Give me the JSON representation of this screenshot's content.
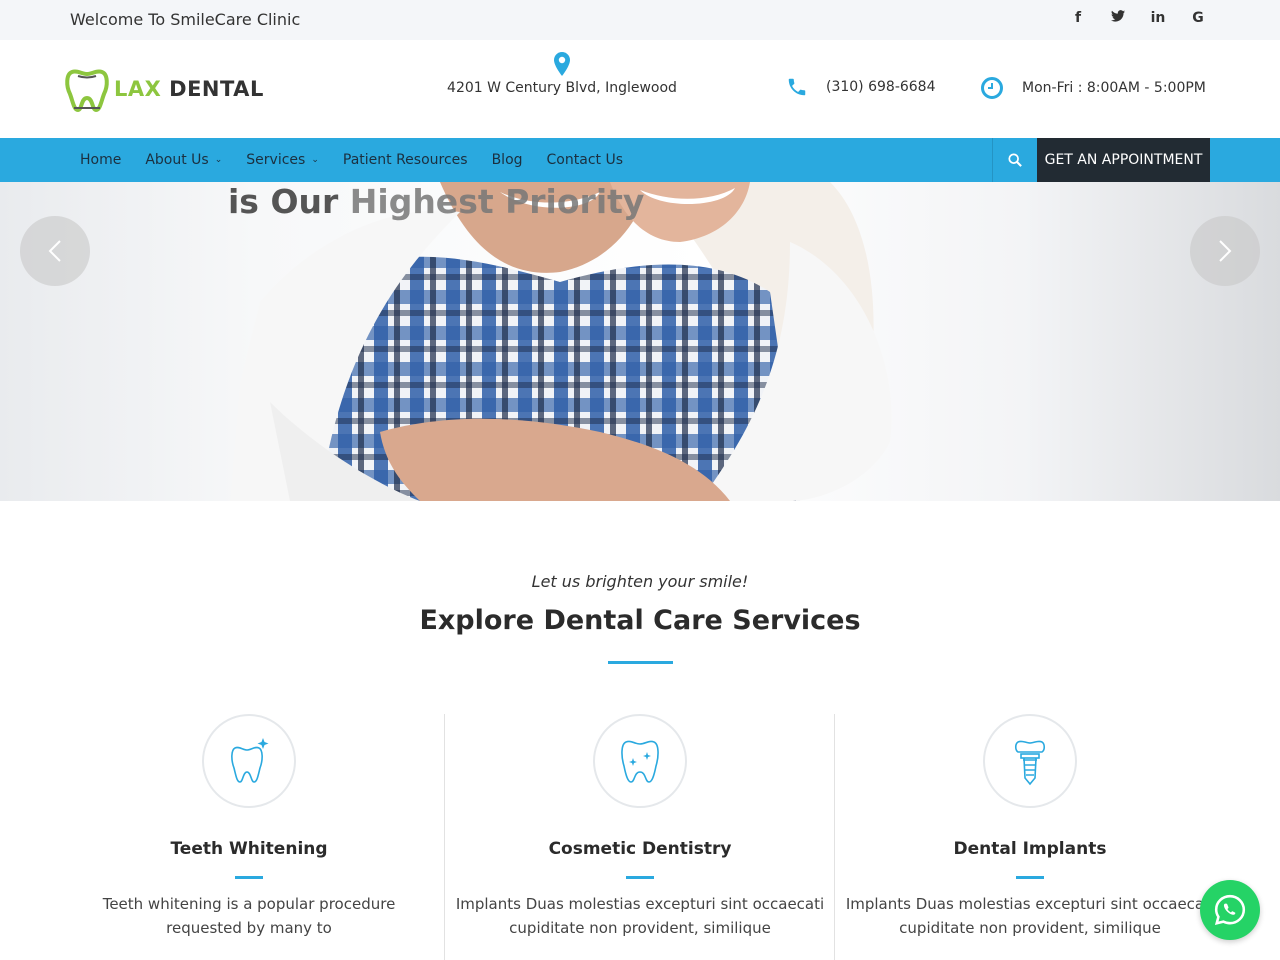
{
  "topbar": {
    "welcome": "Welcome To SmileCare Clinic",
    "social": [
      {
        "icon": "facebook-icon",
        "glyph": "f"
      },
      {
        "icon": "twitter-icon",
        "glyph": "t"
      },
      {
        "icon": "linkedin-icon",
        "glyph": "in"
      },
      {
        "icon": "google-icon",
        "glyph": "G"
      }
    ]
  },
  "header": {
    "brand_part1": "LAX",
    "brand_part2": "DENTAL",
    "address": "4201 W Century Blvd, Inglewood",
    "phone": "(310) 698-6684",
    "hours": "Mon-Fri : 8:00AM - 5:00PM"
  },
  "nav": {
    "items": [
      {
        "label": "Home",
        "caret": false
      },
      {
        "label": "About Us",
        "caret": true
      },
      {
        "label": "Services",
        "caret": true
      },
      {
        "label": "Patient Resources",
        "caret": false
      },
      {
        "label": "Blog",
        "caret": false
      },
      {
        "label": "Contact Us",
        "caret": false
      }
    ],
    "cta": "GET AN APPOINTMENT"
  },
  "hero": {
    "headline_part1": "is Our",
    "headline_part2": "Highest Priority"
  },
  "intro": {
    "subtitle": "Let us brighten your smile!",
    "title": "Explore Dental Care Services"
  },
  "services": [
    {
      "name": "Teeth Whitening",
      "desc": "Teeth whitening is a popular procedure requested by many to",
      "icon": "tooth-sparkle-icon"
    },
    {
      "name": "Cosmetic Dentistry",
      "desc": "Implants Duas molestias excepturi sint occaecati cupiditate non provident, similique",
      "icon": "cosmetic-tooth-icon"
    },
    {
      "name": "Dental Implants",
      "desc": "Implants Duas molestias excepturi sint occaecati cupiditate non provident, similique",
      "icon": "implant-icon"
    }
  ],
  "colors": {
    "accent": "#2aa9df",
    "dark": "#222b33",
    "brand_green": "#8dc63f",
    "whatsapp": "#25d366"
  }
}
